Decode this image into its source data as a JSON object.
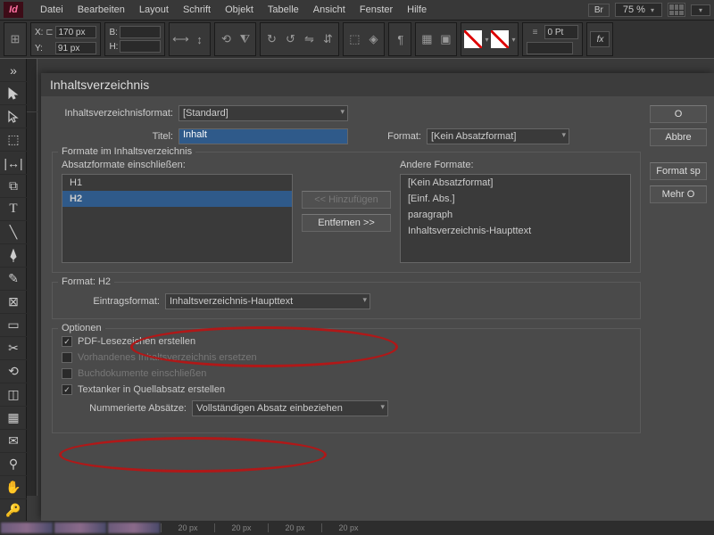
{
  "app": {
    "logo": "Id"
  },
  "menu": [
    "Datei",
    "Bearbeiten",
    "Layout",
    "Schrift",
    "Objekt",
    "Tabelle",
    "Ansicht",
    "Fenster",
    "Hilfe"
  ],
  "topRight": {
    "br": "Br",
    "zoom": "75 %"
  },
  "ctrl": {
    "x": "170 px",
    "y": "91 px",
    "b": "",
    "h": "",
    "stroke": "0 Pt",
    "fx": "fx"
  },
  "dialog": {
    "title": "Inhaltsverzeichnis",
    "tocFormatLbl": "Inhaltsverzeichnisformat:",
    "tocFormat": "[Standard]",
    "titleLbl": "Titel:",
    "titleVal": "Inhalt",
    "formatLbl": "Format:",
    "formatVal": "[Kein Absatzformat]",
    "section1": "Formate im Inhaltsverzeichnis",
    "includeLbl": "Absatzformate einschließen:",
    "includeList": [
      "H1",
      "H2"
    ],
    "otherLbl": "Andere Formate:",
    "otherList": [
      "[Kein Absatzformat]",
      "[Einf. Abs.]",
      "paragraph",
      "Inhaltsverzeichnis-Haupttext"
    ],
    "addBtn": "<< Hinzufügen",
    "removeBtn": "Entfernen >>",
    "fmtLine": "Format: H2",
    "entryFmtLbl": "Eintragsformat:",
    "entryFmtVal": "Inhaltsverzeichnis-Haupttext",
    "optionsTitle": "Optionen",
    "opt1": "PDF-Lesezeichen erstellen",
    "opt2": "Vorhandenes Inhaltsverzeichnis ersetzen",
    "opt3": "Buchdokumente einschließen",
    "opt4": "Textanker in Quellabsatz erstellen",
    "numLbl": "Nummerierte Absätze:",
    "numVal": "Vollständigen Absatz einbeziehen",
    "sideBtns": [
      "O",
      "Abbre",
      "Format sp",
      "Mehr O"
    ]
  },
  "ruler": [
    "20 px",
    "20 px",
    "20 px",
    "20 px"
  ]
}
